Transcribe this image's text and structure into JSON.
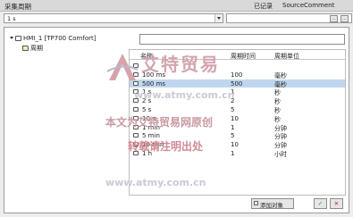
{
  "window": {
    "title": "采集周期",
    "records_label": "已记录",
    "source_comment": "SourceComment"
  },
  "combo": {
    "value": "1 s"
  },
  "sidebox": {
    "button1": "...",
    "button2": "..."
  },
  "tree": {
    "root": "HMI_1 [TP700 Comfort]",
    "child": "周期"
  },
  "table": {
    "headers": [
      "名称",
      "周期时间",
      "周期单位"
    ],
    "rows": [
      {
        "name": "",
        "time": "",
        "unit": ""
      },
      {
        "name": "100 ms",
        "time": "100",
        "unit": "毫秒"
      },
      {
        "name": "500 ms",
        "time": "500",
        "unit": "毫秒"
      },
      {
        "name": "1 s",
        "time": "1",
        "unit": "秒"
      },
      {
        "name": "2 s",
        "time": "2",
        "unit": "秒"
      },
      {
        "name": "5 s",
        "time": "5",
        "unit": "秒"
      },
      {
        "name": "10 s",
        "time": "10",
        "unit": "秒"
      },
      {
        "name": "1 min",
        "time": "1",
        "unit": "分钟"
      },
      {
        "name": "5 min",
        "time": "5",
        "unit": "分钟"
      },
      {
        "name": "10 min",
        "time": "10",
        "unit": "分钟"
      },
      {
        "name": "1 h",
        "time": "1",
        "unit": "小时"
      }
    ],
    "selected_row": 2
  },
  "buttons": {
    "add_object": "添加对象",
    "ok": "✓",
    "cancel": "✕"
  },
  "watermark": {
    "logo_text": "艾特贸易",
    "url1": "www.atmy.com.cn",
    "line1": "本文为艾特贸易网原创",
    "line2": "转载请注明出处",
    "url2": "www.atmy.com.cn"
  },
  "colors": {
    "selected_row": "#c0d6ee",
    "watermark_red": "#d48a94"
  }
}
